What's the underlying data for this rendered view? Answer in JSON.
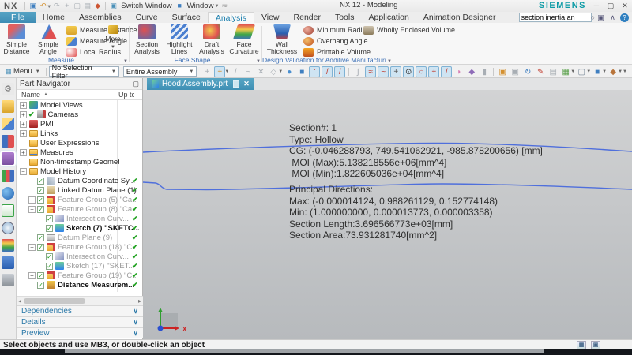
{
  "title_bar": {
    "app_logo": "NX",
    "title": "NX 12 - Modeling",
    "brand": "SIEMENS",
    "switch_window_label": "Switch Window",
    "window_label": "Window",
    "quick_access": [
      {
        "name": "save-icon",
        "glyph": "▣",
        "color": "#3f7fc0"
      },
      {
        "name": "undo-icon",
        "glyph": "↶",
        "color": "#d4902f",
        "caret": true
      },
      {
        "name": "redo-icon",
        "glyph": "↷",
        "color": "#a8aeb4"
      },
      {
        "name": "cut-icon",
        "glyph": "+",
        "color": "#a8aeb4"
      },
      {
        "name": "copy-icon",
        "glyph": "▢",
        "color": "#a8aeb4"
      },
      {
        "name": "paste-icon",
        "glyph": "▤",
        "color": "#a8aeb4"
      },
      {
        "name": "repeat-command-icon",
        "glyph": "◆",
        "color": "#cc5533"
      }
    ],
    "window_controls": [
      "─",
      "▢",
      "✕"
    ]
  },
  "ribbon_tabs": {
    "file_label": "File",
    "tabs": [
      "Home",
      "Assemblies",
      "Curve",
      "Surface",
      "Analysis",
      "View",
      "Render",
      "Tools",
      "Application",
      "Animation Designer"
    ],
    "active_tab": "Analysis",
    "search_value": "section inertia an"
  },
  "ribbon": {
    "groups": [
      {
        "label": "Measure",
        "large": [
          "Simple Distance",
          "Simple Angle"
        ],
        "small": [
          "Measure Distance",
          "Measure Angle",
          "Local Radius"
        ],
        "more": "More"
      },
      {
        "label": "Face Shape",
        "large": [
          "Section Analysis",
          "Highlight Lines",
          "Draft Analysis",
          "Face Curvature"
        ]
      },
      {
        "label": "Design Validation for Additive Manufacturing",
        "large": [
          "Wall Thickness"
        ],
        "small": [
          "Minimum Radii",
          "Overhang Angle",
          "Printable Volume"
        ],
        "small2": [
          "Wholly Enclosed Volume"
        ]
      }
    ]
  },
  "toolbar": {
    "menu_label": "Menu",
    "selection_filter": "No Selection Filter",
    "selection_scope": "Entire Assembly",
    "icons": [
      {
        "name": "snap-enable-icon",
        "glyph": "+",
        "color": "#a8aeb4"
      },
      {
        "name": "point-dialog-icon",
        "glyph": "+",
        "color": "#d4902f",
        "selected": true,
        "caret": true
      },
      {
        "name": "end-point-icon",
        "glyph": "/",
        "color": "#a8aeb4"
      },
      {
        "name": "mid-point-icon",
        "glyph": "~",
        "color": "#a8aeb4"
      },
      {
        "name": "intersection-point-icon",
        "glyph": "✕",
        "color": "#a8aeb4"
      },
      {
        "name": "arc-center-icon",
        "glyph": "◇",
        "color": "#a8aeb4",
        "caret": true
      },
      {
        "name": "quadrant-point-icon",
        "glyph": "●",
        "color": "#4a8fd0"
      },
      {
        "name": "existing-point-icon",
        "glyph": "■",
        "color": "#3f7fc0"
      },
      {
        "name": "point-on-curve-icon",
        "glyph": "∴",
        "color": "#c0392b",
        "selected": true
      },
      {
        "name": "point-on-line-icon",
        "glyph": "/",
        "color": "#c0392b",
        "selected": true
      },
      {
        "name": "point-on-axis-icon",
        "glyph": "/",
        "color": "#c0392b",
        "selected": true
      },
      {
        "name": "tangent-snap-icon",
        "glyph": "∫",
        "color": "#a8aeb4",
        "sep": true
      },
      {
        "name": "spline-point-icon",
        "glyph": "≈",
        "color": "#c0392b",
        "selected": true
      },
      {
        "name": "pole-point-icon",
        "glyph": "~",
        "color": "#c0392b",
        "selected": true
      },
      {
        "name": "datum-axis-icon",
        "glyph": "+",
        "color": "#555555",
        "selected": true
      },
      {
        "name": "circle-center-icon",
        "glyph": "⊙",
        "color": "#333333",
        "selected": true
      },
      {
        "name": "circle-snap-icon",
        "glyph": "○",
        "color": "#c0392b",
        "selected": true
      },
      {
        "name": "plus-point-icon",
        "glyph": "+",
        "color": "#c0392b",
        "selected": true
      },
      {
        "name": "slash-point-icon",
        "glyph": "/",
        "color": "#c0392b",
        "selected": true
      },
      {
        "name": "face-snap-icon",
        "glyph": "◗",
        "color": "#d77fb4"
      },
      {
        "name": "facet-body-icon",
        "glyph": "◆",
        "color": "#8e6bb8"
      },
      {
        "name": "interpart-icon",
        "glyph": "▮",
        "color": "#a8aeb4"
      },
      {
        "name": "window-cascade-icon",
        "glyph": "▣",
        "color": "#d4902f",
        "sep": true
      },
      {
        "name": "window-tile-icon",
        "glyph": "▣",
        "color": "#a8aeb4"
      },
      {
        "name": "refresh-icon",
        "glyph": "↻",
        "color": "#3f7fc0"
      },
      {
        "name": "brush-icon",
        "glyph": "✎",
        "color": "#c0392b"
      },
      {
        "name": "layers-icon",
        "glyph": "▤",
        "color": "#a8aeb4"
      },
      {
        "name": "grid-icon",
        "glyph": "▦",
        "color": "#5aa04a",
        "caret": true
      },
      {
        "name": "display-mode-icon",
        "glyph": "▢",
        "color": "#7a8a99",
        "caret": true
      },
      {
        "name": "view-orient-icon",
        "glyph": "■",
        "color": "#3f7fc0",
        "caret": true
      },
      {
        "name": "snap-views-icon",
        "glyph": "◆",
        "color": "#b8743a",
        "caret": true
      }
    ]
  },
  "resource_bar": {
    "icons": [
      {
        "name": "screen-gear-icon",
        "glyph": "⚙",
        "cls": "r0"
      },
      {
        "name": "roles-icon",
        "glyph": "",
        "cls": "r1"
      },
      {
        "name": "assembly-navigator-icon",
        "glyph": "",
        "cls": "r2"
      },
      {
        "name": "constraint-navigator-icon",
        "glyph": "",
        "cls": "r3"
      },
      {
        "name": "part-navigator-icon",
        "glyph": "",
        "cls": "r4",
        "selected": true
      },
      {
        "name": "reuse-library-icon",
        "glyph": "",
        "cls": "r5"
      },
      {
        "name": "web-browser-icon",
        "glyph": "",
        "cls": "r6"
      },
      {
        "name": "templates-icon",
        "glyph": "",
        "cls": "r7"
      },
      {
        "name": "history-icon",
        "glyph": "",
        "cls": "r8"
      },
      {
        "name": "visualization-icon",
        "glyph": "",
        "cls": "r9"
      },
      {
        "name": "kinematics-icon",
        "glyph": "",
        "cls": "r10"
      },
      {
        "name": "machine-tool-icon",
        "glyph": "",
        "cls": "r11"
      }
    ]
  },
  "part_navigator": {
    "title": "Part Navigator",
    "columns": {
      "name": "Name",
      "up_to": "Up to"
    },
    "tree": [
      {
        "label": "Model Views",
        "level": 0,
        "expander": "+",
        "icon": "t-mv",
        "state": "dark"
      },
      {
        "label": "Cameras",
        "level": 0,
        "expander": "+",
        "icon": "t-cam",
        "state": "dark",
        "precheck": true
      },
      {
        "label": "PMI",
        "level": 0,
        "expander": "+",
        "icon": "t-pmi",
        "state": "dark"
      },
      {
        "label": "Links",
        "level": 0,
        "expander": "+",
        "icon": "t-folder",
        "state": "dark"
      },
      {
        "label": "User Expressions",
        "level": 0,
        "expander": "",
        "icon": "t-folder",
        "state": "dark"
      },
      {
        "label": "Measures",
        "level": 0,
        "expander": "+",
        "icon": "t-foldm",
        "state": "dark"
      },
      {
        "label": "Non-timestamp Geometry",
        "level": 0,
        "expander": "",
        "icon": "t-folder",
        "state": "dark"
      },
      {
        "label": "Model History",
        "level": 0,
        "expander": "-",
        "icon": "t-folder",
        "state": "dark"
      },
      {
        "label": "Datum Coordinate Sy...",
        "level": 1,
        "checkbox": true,
        "icon": "t-csys",
        "state": "dark",
        "check": true
      },
      {
        "label": "Linked Datum Plane (1)",
        "level": 1,
        "checkbox": true,
        "icon": "t-ldp",
        "state": "dark",
        "check": true
      },
      {
        "label": "Feature Group (5) \"Ca...",
        "level": 1,
        "expander": "+",
        "checkbox": true,
        "icon": "t-fg",
        "state": "gray",
        "check": true
      },
      {
        "label": "Feature Group (8) \"Ca...",
        "level": 1,
        "expander": "-",
        "checkbox": true,
        "icon": "t-fg",
        "state": "gray",
        "check": true
      },
      {
        "label": "Intersection Curv...",
        "level": 2,
        "checkbox": true,
        "icon": "t-int",
        "state": "gray",
        "check": true
      },
      {
        "label": "Sketch (7) \"SKETC...",
        "level": 2,
        "checkbox": true,
        "icon": "t-sk",
        "state": "bold",
        "check": true
      },
      {
        "label": "Datum Plane (9)",
        "level": 1,
        "checkbox": true,
        "icon": "t-dp",
        "state": "gray",
        "check": true
      },
      {
        "label": "Feature Group (18) \"C...",
        "level": 1,
        "expander": "-",
        "checkbox": true,
        "icon": "t-fg",
        "state": "gray",
        "check": true
      },
      {
        "label": "Intersection Curv...",
        "level": 2,
        "checkbox": true,
        "icon": "t-int",
        "state": "gray",
        "check": true
      },
      {
        "label": "Sketch (17) \"SKET...",
        "level": 2,
        "checkbox": true,
        "icon": "t-sk",
        "state": "gray",
        "check": true
      },
      {
        "label": "Feature Group (19) \"C...",
        "level": 1,
        "expander": "+",
        "checkbox": true,
        "icon": "t-fg",
        "state": "gray",
        "check": true
      },
      {
        "label": "Distance Measurem...",
        "level": 1,
        "checkbox": true,
        "icon": "t-meas",
        "state": "bold",
        "check": true
      }
    ],
    "sections": [
      "Dependencies",
      "Details",
      "Preview"
    ]
  },
  "viewport": {
    "tab_title": "Hood Assembly.prt",
    "analysis_text": [
      "Section#: 1",
      "Type: Hollow",
      "CG: (-0.046288793, 749.541062921, -985.878200656) [mm]",
      " MOI (Max):5.138218556e+06[mm^4]",
      " MOI (Min):1.822605036e+04[mm^4]",
      "Principal Directions:",
      "Max: (-0.000014124, 0.988261129, 0.152774148)",
      "Min: (1.000000000, 0.000013773, 0.000003358)",
      "Section Length:3.696566773e+03[mm]",
      "Section Area:73.931281740[mm^2]"
    ],
    "triad_x_label": "X"
  },
  "status_bar": {
    "message": "Select objects and use MB3, or double-click an object"
  },
  "colors": {
    "accent_teal": "#3e8fb4",
    "tab_text_blue": "#1b7fae",
    "group_label_blue": "#3a6eb5",
    "check_green": "#1fa11f",
    "curve_blue": "#4f6fdc",
    "brand_teal": "#0a9aa5"
  }
}
